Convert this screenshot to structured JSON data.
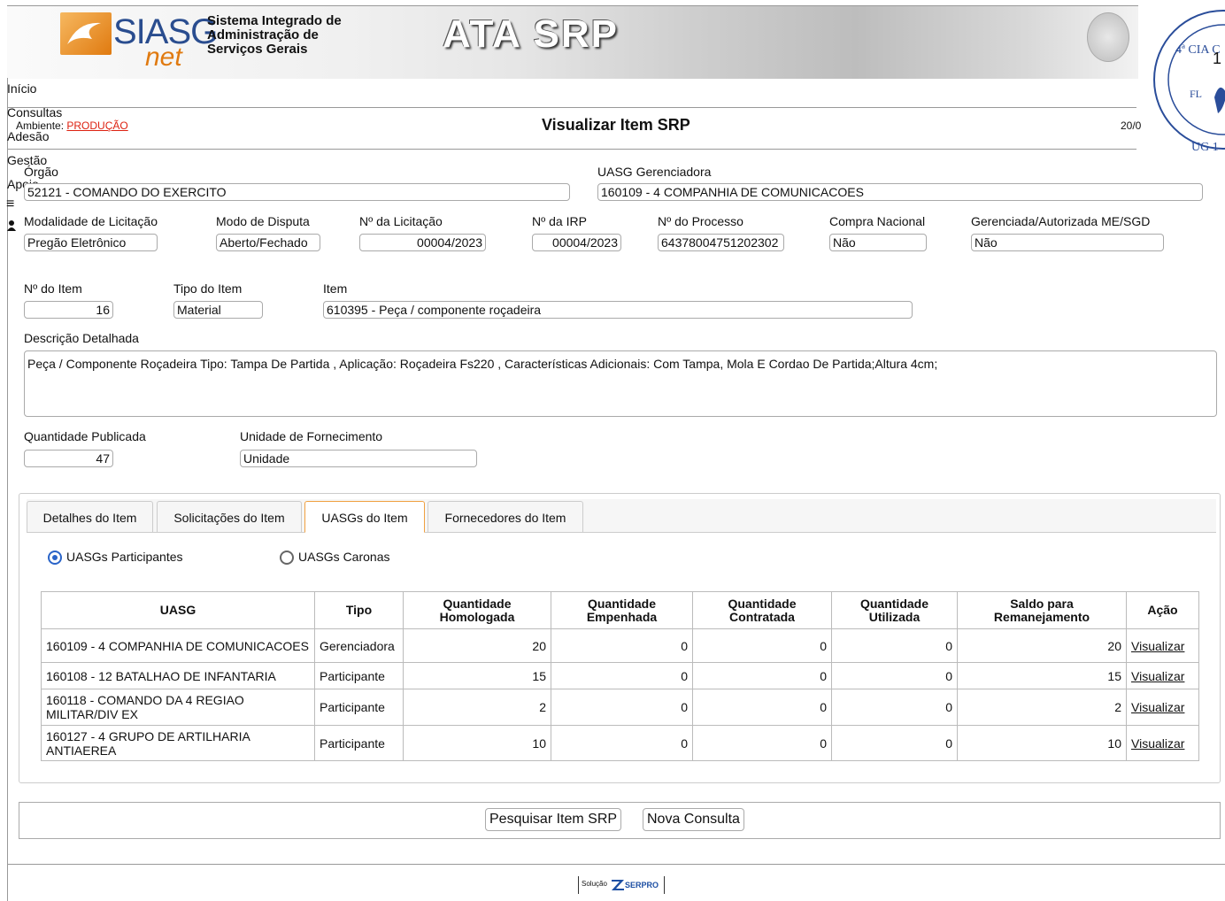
{
  "header": {
    "logo_siasg": "SIASG",
    "logo_net": "net",
    "system_name_line1": "Sistema Integrado de",
    "system_name_line2": "Administração de",
    "system_name_line3": "Serviços Gerais",
    "banner_title": "ATA SRP",
    "stamp_number": "1",
    "stamp_text": "4ª CIA C FL UG 1"
  },
  "nav": [
    "Início",
    "Consultas",
    "Adesão",
    "Gestão",
    "Apoio"
  ],
  "page": {
    "ambiente_label": "Ambiente:",
    "ambiente_value": "PRODUÇÃO",
    "title": "Visualizar Item SRP",
    "date": "20/0"
  },
  "form": {
    "orgao_label": "Órgão",
    "orgao_value": "52121 - COMANDO DO EXERCITO",
    "uasg_label": "UASG Gerenciadora",
    "uasg_value": "160109 - 4 COMPANHIA DE COMUNICACOES",
    "modalidade_label": "Modalidade de Licitação",
    "modalidade_value": "Pregão Eletrônico",
    "modo_label": "Modo de Disputa",
    "modo_value": "Aberto/Fechado",
    "licitacao_label": "Nº da Licitação",
    "licitacao_value": "00004/2023",
    "irp_label": "Nº da IRP",
    "irp_value": "00004/2023",
    "processo_label": "Nº do Processo",
    "processo_value": "64378004751202302",
    "compra_label": "Compra Nacional",
    "compra_value": "Não",
    "gerenciada_label": "Gerenciada/Autorizada ME/SGD",
    "gerenciada_value": "Não",
    "num_item_label": "Nº do Item",
    "num_item_value": "16",
    "tipo_item_label": "Tipo do Item",
    "tipo_item_value": "Material",
    "item_label": "Item",
    "item_value": "610395 - Peça / componente roçadeira",
    "descricao_label": "Descrição Detalhada",
    "descricao_value": "Peça / Componente Roçadeira Tipo: Tampa De Partida , Aplicação: Roçadeira Fs220 , Características Adicionais: Com Tampa, Mola E Cordao De Partida;Altura 4cm;",
    "qtd_label": "Quantidade Publicada",
    "qtd_value": "47",
    "unidade_label": "Unidade de Fornecimento",
    "unidade_value": "Unidade"
  },
  "tabs": [
    "Detalhes do Item",
    "Solicitações do Item",
    "UASGs do Item",
    "Fornecedores do Item"
  ],
  "radios": {
    "participantes": "UASGs Participantes",
    "caronas": "UASGs Caronas"
  },
  "table": {
    "headers": [
      "UASG",
      "Tipo",
      "Quantidade Homologada",
      "Quantidade Empenhada",
      "Quantidade Contratada",
      "Quantidade Utilizada",
      "Saldo para Remanejamento",
      "Ação"
    ],
    "rows": [
      {
        "uasg": "160109 - 4 COMPANHIA DE COMUNICACOES",
        "tipo": "Gerenciadora",
        "homologada": "20",
        "empenhada": "0",
        "contratada": "0",
        "utilizada": "0",
        "saldo": "20",
        "acao": "Visualizar"
      },
      {
        "uasg": "160108 - 12 BATALHAO DE INFANTARIA",
        "tipo": "Participante",
        "homologada": "15",
        "empenhada": "0",
        "contratada": "0",
        "utilizada": "0",
        "saldo": "15",
        "acao": "Visualizar"
      },
      {
        "uasg": "160118 - COMANDO DA 4 REGIAO MILITAR/DIV EX",
        "tipo": "Participante",
        "homologada": "2",
        "empenhada": "0",
        "contratada": "0",
        "utilizada": "0",
        "saldo": "2",
        "acao": "Visualizar"
      },
      {
        "uasg": "160127 - 4 GRUPO DE ARTILHARIA ANTIAEREA",
        "tipo": "Participante",
        "homologada": "10",
        "empenhada": "0",
        "contratada": "0",
        "utilizada": "0",
        "saldo": "10",
        "acao": "Visualizar"
      }
    ]
  },
  "buttons": {
    "pesquisar": "Pesquisar Item SRP",
    "nova": "Nova Consulta"
  },
  "footer": {
    "solucao": "Solução",
    "serpro": "SERPRO"
  },
  "colors": {
    "accent_tab": "#f0a040",
    "link_red": "#dd2211",
    "radio_blue": "#2a64c8"
  }
}
